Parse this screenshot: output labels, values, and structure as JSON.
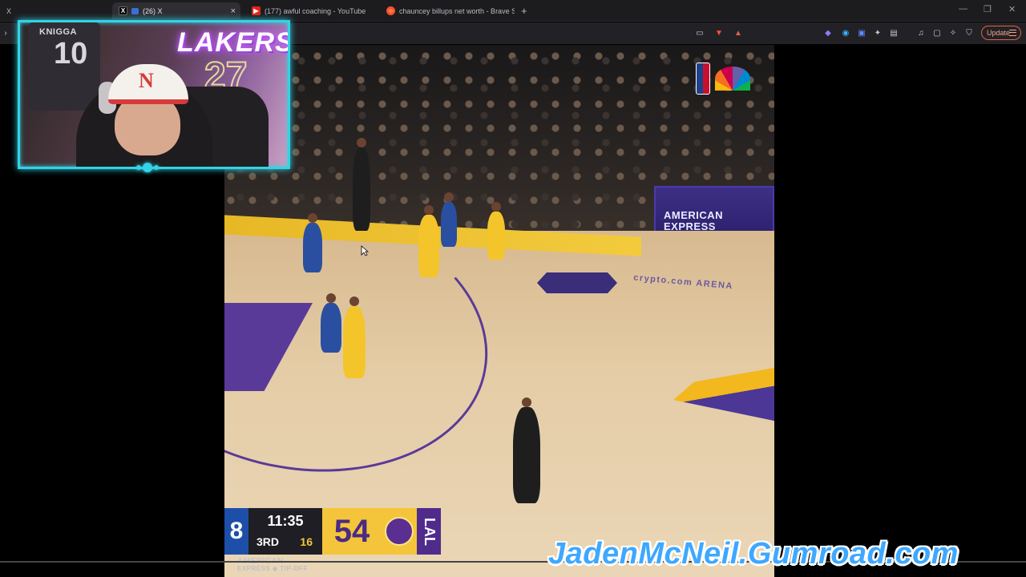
{
  "browser": {
    "tabs": [
      {
        "label": "X",
        "icon": "x-icon"
      },
      {
        "label": "(26) X",
        "icon": "x-icon",
        "active": true
      },
      {
        "label": "(177) awful coaching - YouTube",
        "icon": "youtube-icon"
      },
      {
        "label": "chauncey billups net worth - Brave S...",
        "icon": "brave-search-icon"
      }
    ],
    "new_tab_label": "+",
    "update_label": "Update"
  },
  "scorebug": {
    "away_score_partial": "8",
    "clock": "11:35",
    "period": "3RD",
    "shot_clock": "16",
    "home_score": "54",
    "home_team": "LAL",
    "sponsor_line1": "AMERICAN",
    "sponsor_line2": "EXPRESS",
    "sponsor_line3": "TIP-OFF"
  },
  "court": {
    "sign_text_1": "AMERICAN",
    "sign_text_2": "EXPRESS",
    "arena_text": "crypto.com ARENA"
  },
  "webcam": {
    "jersey_name": "KNIGGA",
    "jersey_number": "10",
    "neon_sign": "LAKERS",
    "neon_number": "27",
    "cap_letter": "N"
  },
  "watermark": "JadenMcNeil.Gumroad.com",
  "colors": {
    "webcam_border": "#32d3e6",
    "lakers_gold": "#f4c53a",
    "lakers_purple": "#4f2b8c",
    "watermark_blue": "#3ea8ff"
  }
}
